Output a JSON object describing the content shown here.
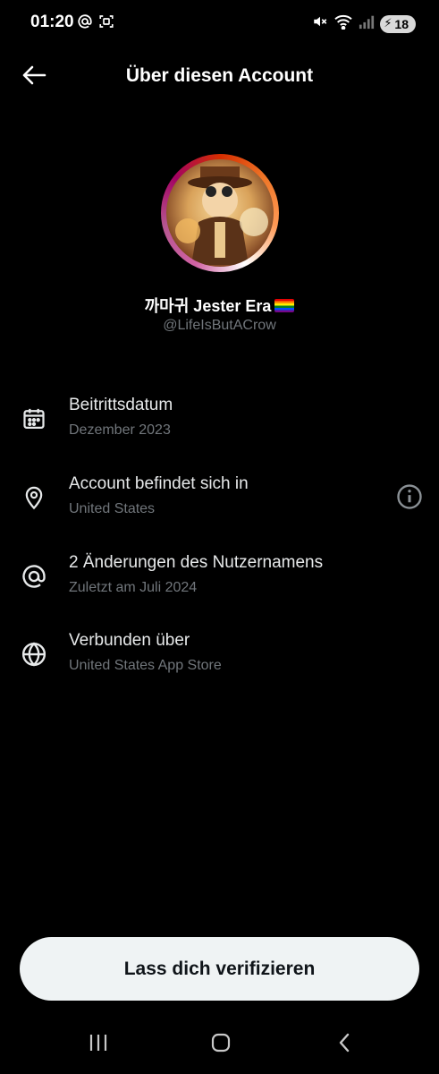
{
  "status_bar": {
    "time": "01:20",
    "battery": "18",
    "icons": [
      "at-icon",
      "screenshot-icon",
      "mute-icon",
      "wifi-icon",
      "signal-icon",
      "battery-icon"
    ]
  },
  "header": {
    "title": "Über diesen Account",
    "back_icon": "arrow-left-icon"
  },
  "profile": {
    "display_name": "까마귀 Jester Era",
    "handle": "@LifeIsButACrow"
  },
  "info": {
    "items": [
      {
        "icon": "calendar-icon",
        "title": "Beitrittsdatum",
        "subtitle": "Dezember 2023"
      },
      {
        "icon": "location-pin-icon",
        "title": "Account befindet sich in",
        "subtitle": "United States",
        "action_icon": "info-icon"
      },
      {
        "icon": "at-sign-icon",
        "title": "2 Änderungen des Nutzernamens",
        "subtitle": "Zuletzt am Juli 2024"
      },
      {
        "icon": "globe-icon",
        "title": "Verbunden über",
        "subtitle": "United States App Store"
      }
    ]
  },
  "verify": {
    "label": "Lass dich verifizieren"
  },
  "nav": {
    "icons": [
      "recent-apps-icon",
      "home-icon",
      "back-icon"
    ]
  },
  "colors": {
    "background": "#000000",
    "primary_text": "#e7e9ea",
    "secondary_text": "#71767b",
    "button_bg": "#eff3f4",
    "button_text": "#0f1419"
  }
}
